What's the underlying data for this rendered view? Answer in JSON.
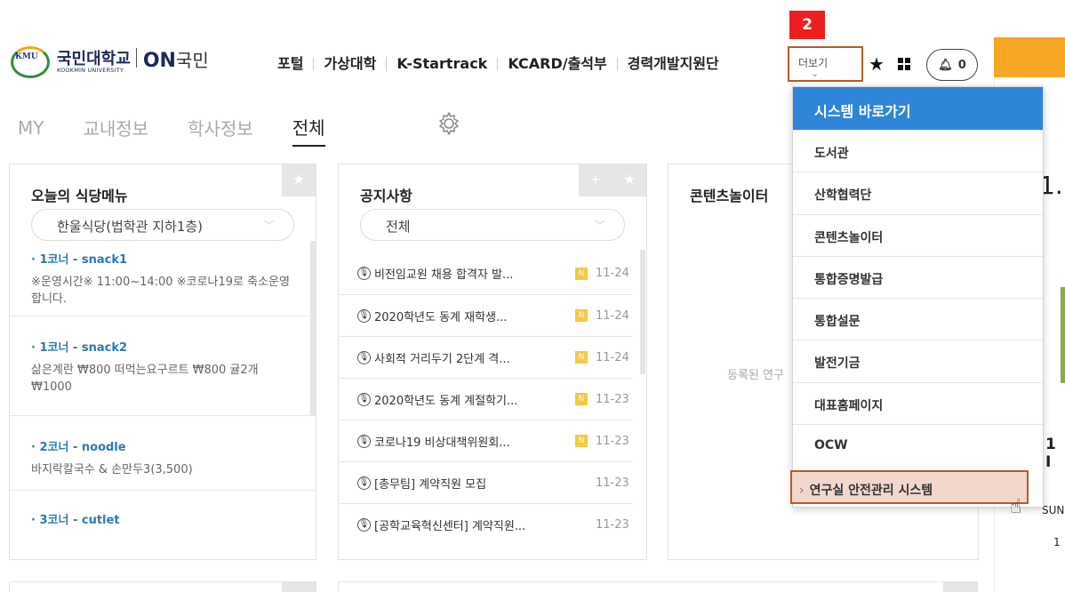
{
  "header": {
    "logo_emblem": "KMU",
    "logo_name": "국민대학교",
    "logo_sub": "KOOKMIN UNIVERSITY",
    "logo_on": "ON",
    "logo_on_suffix": "국민",
    "nav": [
      "포털",
      "가상대학",
      "K-Startrack",
      "KCARD/출석부",
      "경력개발지원단"
    ],
    "more_label": "더보기",
    "badge": "2",
    "notif_count": "0"
  },
  "tabs": [
    {
      "label": "MY",
      "active": false
    },
    {
      "label": "교내정보",
      "active": false
    },
    {
      "label": "학사정보",
      "active": false
    },
    {
      "label": "전체",
      "active": true
    }
  ],
  "cafeteria": {
    "title": "오늘의 식당메뉴",
    "select": "한울식당(법학관 지하1층)",
    "items": [
      {
        "name": "· 1코너 - snack1",
        "desc": "※운영시간※ 11:00~14:00 ※코로나19로 축소운영합니다."
      },
      {
        "name": "· 1코너 - snack2",
        "desc": "삶은계란 ₩800 떠먹는요구르트 ₩800 귤2개 ₩1000"
      },
      {
        "name": "· 2코너 - noodle",
        "desc": "바지락칼국수 & 손만두3(3,500)"
      },
      {
        "name": "· 3코너 - cutlet",
        "desc": ""
      }
    ]
  },
  "notices": {
    "title": "공지사항",
    "select": "전체",
    "items": [
      {
        "title": "비전임교원 채용 합격자 발...",
        "new": true,
        "date": "11-24"
      },
      {
        "title": "2020학년도 동계 재학생...",
        "new": true,
        "date": "11-24"
      },
      {
        "title": "사회적 거리두기 2단계 격...",
        "new": true,
        "date": "11-24"
      },
      {
        "title": "2020학년도 동계 계절학기...",
        "new": true,
        "date": "11-23"
      },
      {
        "title": "코로나19 비상대책위원회...",
        "new": true,
        "date": "11-23"
      },
      {
        "title": "[총무팀] 계약직원 모집",
        "new": false,
        "date": "11-23"
      },
      {
        "title": "[공학교육혁신센터] 계약직원...",
        "new": false,
        "date": "11-23"
      }
    ],
    "new_mark": "N"
  },
  "contents": {
    "title": "콘텐츠놀이터",
    "empty": "등록된 연구"
  },
  "dropdown": {
    "header": "시스템 바로가기",
    "items": [
      "도서관",
      "산학협력단",
      "콘텐츠놀이터",
      "통합증명발급",
      "통합설문",
      "발전기금",
      "대표홈페이지",
      "OCW"
    ],
    "selected": "연구실 안전관리 시스템"
  },
  "right_fragments": {
    "big": "1.",
    "mid": "1 I",
    "sun": "SUN",
    "one": "1"
  }
}
